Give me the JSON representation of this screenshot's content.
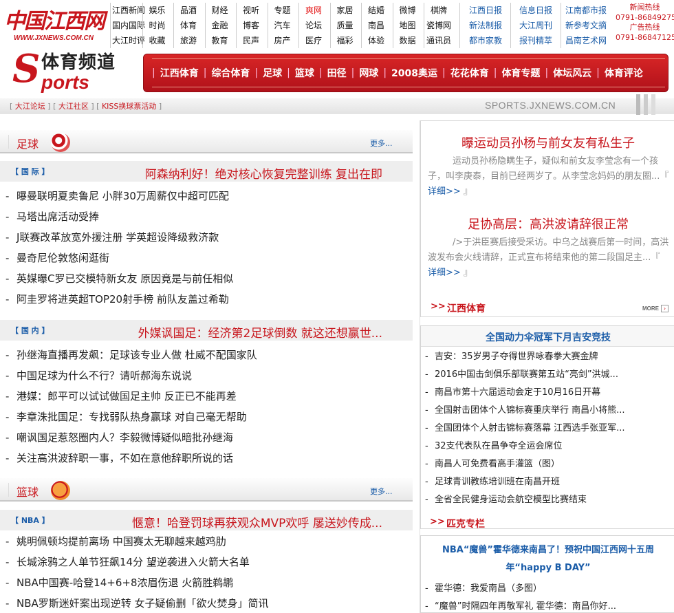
{
  "site": {
    "brand": "中国江西网",
    "url": "WWW.JXNEWS.COM.CN"
  },
  "nav": {
    "columns": [
      [
        "江西新闻",
        "国内国际",
        "大江时评"
      ],
      [
        "娱乐",
        "时尚",
        "收藏"
      ],
      [
        "品酒",
        "体育",
        "旅游"
      ],
      [
        "财经",
        "金融",
        "教育"
      ],
      [
        "视听",
        "博客",
        "民声"
      ],
      [
        "专题",
        "汽车",
        "房产"
      ],
      [
        "爽网",
        "论坛",
        "医疗"
      ],
      [
        "家居",
        "质量",
        "福彩"
      ],
      [
        "结婚",
        "南昌",
        "体验"
      ],
      [
        "微博",
        "地图",
        "数据"
      ],
      [
        "棋牌",
        "瓷博网",
        "通讯员"
      ]
    ],
    "highlight": "爽网",
    "papers": [
      [
        "江西日报",
        "新法制报",
        "都市家教"
      ],
      [
        "信息日报",
        "大江周刊",
        "报刊精萃"
      ],
      [
        "江南都市报",
        "新参考文摘",
        "昌南艺术网"
      ]
    ],
    "hotline": {
      "label1": "新闻热线",
      "phone1": "0791-86849275",
      "label2": "广告热线",
      "phone2": "0791-86847125"
    }
  },
  "channel": {
    "title_cn": "体育频道",
    "title_en": "ports",
    "s_letter": "S",
    "menu": [
      "江西体育",
      "综合体育",
      "足球",
      "篮球",
      "田径",
      "网球",
      "2008奥运",
      "花花体育",
      "体育专题",
      "体坛风云",
      "体育评论"
    ]
  },
  "substrip": {
    "links": [
      "大江论坛",
      "大江社区",
      "KISS换球票活动"
    ],
    "site": "SPORTS.JXNEWS.COM.CN"
  },
  "football": {
    "section_title": "足球",
    "more": "更多...",
    "intl": {
      "tag": "【 国 际 】",
      "headline": "阿森纳利好！绝对核心恢复完整训练 复出在即",
      "items": [
        "曝曼联明夏卖鲁尼 小胖30万周薪仅中超可匹配",
        "马塔出席活动受捧",
        "J联赛改革放宽外援注册 学英超设降级救济款",
        "曼奇尼伦敦悠闲逛街",
        "英媒曝C罗已交模特新女友 原因竟是与前任相似",
        "阿圭罗将进英超TOP20射手榜 前队友盖过希勒"
      ]
    },
    "domestic": {
      "tag": "【 国 内 】",
      "headline": "外媒讽国足：经济第2足球倒数 就这还想赢世...",
      "items": [
        "孙继海直播再发飙：足球该专业人做 杜威不配国家队",
        "中国足球为什么不行？请听郝海东说说",
        "港媒：郎平可以试试做国足主帅 反正已不能再差",
        "李章洙批国足：专找弱队热身赢球 对自己毫无帮助",
        "嘲讽国足惹怒圈内人？李毅微博疑似暗批孙继海",
        "关注高洪波辞职一事，不如在意他辞职所说的话"
      ]
    }
  },
  "basketball": {
    "section_title": "篮球",
    "more": "更多...",
    "nba": {
      "tag": "【 NBA 】",
      "headline": "惬意！哈登罚球再获观众MVP欢呼 屡送妙传成...",
      "items": [
        "姚明佩顿均提前离场 中国赛太无聊越来越鸡肋",
        "长城涂鸦之人单节狂飙14分 望逆袭进入火箭大名单",
        "NBA中国赛-哈登14+6+8浓眉伤退 火箭胜鹈鹕",
        "NBA罗斯迷奸案出现逆转 女子疑偷删「欲火焚身」简讯"
      ]
    }
  },
  "right": {
    "feature1": {
      "title": "曝运动员孙杨与前女友有私生子",
      "body": "运动员孙杨隐瞒生子，疑似和前女友李莹念有一个孩子，叫李庚泰，目前已经两岁了。从李莹念妈妈的朋友圈...",
      "detail": "详细>>"
    },
    "feature2": {
      "title": "足协高层：高洪波请辞很正常",
      "body": "/>于洪臣赛后接受采访。中乌之战赛后第一时间，高洪波发布会火线请辞，正式宣布将结束他的第二段国足主...",
      "detail": "详细>>"
    },
    "jx": {
      "label": "江西体育",
      "chev": ">>",
      "more": "MORE",
      "box_title": "全国动力伞冠军下月吉安竞技",
      "items": [
        "吉安：35岁男子夺得世界咏春拳大赛金牌",
        "2016中国击剑俱乐部联赛第五站“亮剑”洪城...",
        "南昌市第十六届运动会定于10月16日开幕",
        "全国射击团体个人锦标赛重庆举行 南昌小将熊...",
        "全国团体个人射击锦标赛落幕 江西选手张亚军...",
        "32支代表队在昌争夺全运会席位",
        "南昌人可免费看高手灌篮（图）",
        "足球青训教练培训班在南昌开班",
        "全省全民健身运动会航空模型比赛结束"
      ]
    },
    "pick": {
      "label": "匹克专栏",
      "chev": ">>",
      "title": "NBA“魔兽”霍华德来南昌了！预祝中国江西网十五周年“happy B DAY”",
      "items": [
        "霍华德：我爱南昌（多图）",
        "“魔兽”时隔四年再敬军礼 霍华德：南昌你好..."
      ]
    }
  }
}
